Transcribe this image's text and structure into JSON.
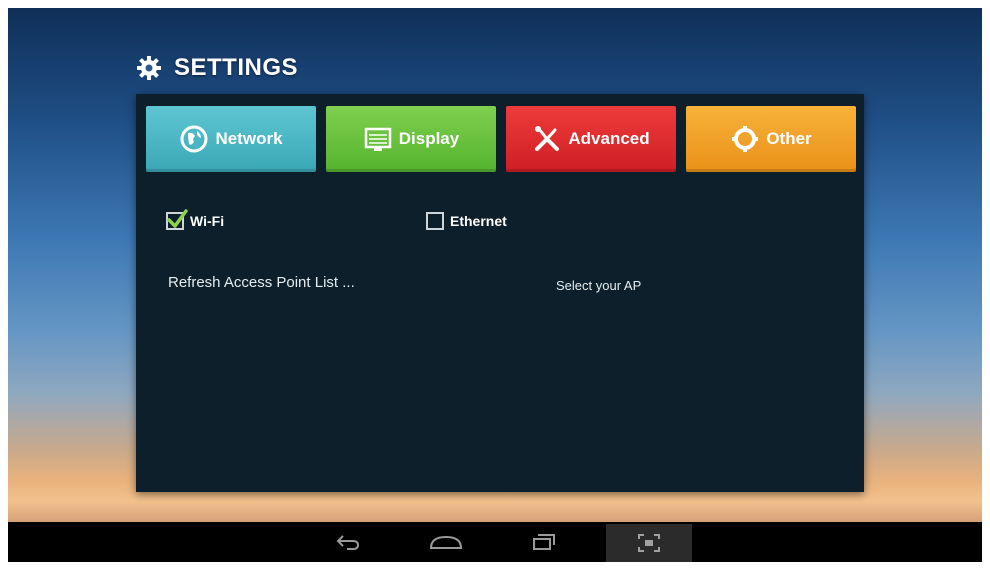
{
  "header": {
    "title": "SETTINGS",
    "icon": "gear-icon"
  },
  "tabs": [
    {
      "label": "Network",
      "icon": "globe-icon",
      "color": "#3aa7b6"
    },
    {
      "label": "Display",
      "icon": "display-icon",
      "color": "#55b32e"
    },
    {
      "label": "Advanced",
      "icon": "tools-icon",
      "color": "#cf1f25"
    },
    {
      "label": "Other",
      "icon": "gear-icon",
      "color": "#e99118"
    }
  ],
  "network": {
    "wifi": {
      "label": "Wi-Fi",
      "checked": true
    },
    "ethernet": {
      "label": "Ethernet",
      "checked": false
    },
    "refresh_label": "Refresh Access Point List ...",
    "select_ap_label": "Select your AP"
  },
  "navbar": {
    "buttons": [
      "back-icon",
      "home-icon",
      "recent-apps-icon",
      "screenshot-icon"
    ]
  },
  "colors": {
    "panel_bg": "#0c1f2b",
    "checkmark": "#8ed14a"
  }
}
